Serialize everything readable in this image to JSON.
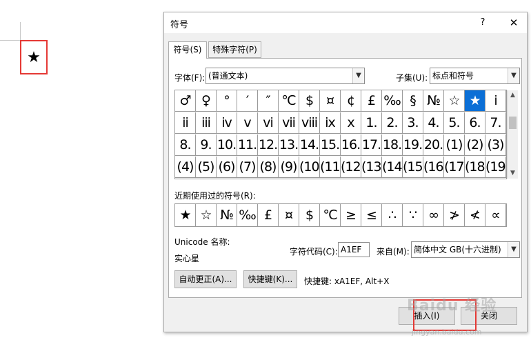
{
  "document": {
    "inserted_symbol": "★"
  },
  "dialog": {
    "title": "符号",
    "help": "?",
    "close": "✕",
    "tabs": [
      {
        "label": "符号(S)"
      },
      {
        "label": "特殊字符(P)"
      }
    ],
    "font": {
      "label": "字体(F):",
      "value": "(普通文本)"
    },
    "subset": {
      "label": "子集(U):",
      "value": "标点和符号"
    },
    "grid": [
      [
        "♂",
        "♀",
        "°",
        "′",
        "″",
        "℃",
        "$",
        "¤",
        "¢",
        "£",
        "‰",
        "§",
        "№",
        "☆",
        "★",
        "i"
      ],
      [
        "ii",
        "iii",
        "iv",
        "v",
        "vi",
        "vii",
        "viii",
        "ix",
        "x",
        "1.",
        "2.",
        "3.",
        "4.",
        "5.",
        "6.",
        "7."
      ],
      [
        "8.",
        "9.",
        "10.",
        "11.",
        "12.",
        "13.",
        "14.",
        "15.",
        "16.",
        "17.",
        "18.",
        "19.",
        "20.",
        "(1)",
        "(2)",
        "(3)"
      ],
      [
        "(4)",
        "(5)",
        "(6)",
        "(7)",
        "(8)",
        "(9)",
        "(10)",
        "(11)",
        "(12)",
        "(13)",
        "(14)",
        "(15)",
        "(16)",
        "(17)",
        "(18)",
        "(19)"
      ]
    ],
    "selected_symbol": "★",
    "recent_label": "近期使用过的符号(R):",
    "recent": [
      "★",
      "☆",
      "№",
      "‰",
      "£",
      "¤",
      "$",
      "℃",
      "≥",
      "≤",
      "∴",
      "∵",
      "∞",
      "≯",
      "≮",
      "∝"
    ],
    "unicode_name_label": "Unicode 名称:",
    "unicode_name": "实心星",
    "char_code": {
      "label": "字符代码(C):",
      "value": "A1EF"
    },
    "from": {
      "label": "来自(M):",
      "value": "简体中文 GB(十六进制)"
    },
    "autocorrect_button": "自动更正(A)...",
    "shortcut_button": "快捷键(K)...",
    "shortcut_text": "快捷键: xA1EF, Alt+X",
    "insert_button": "插入(I)",
    "close_button": "关闭"
  },
  "watermark": {
    "main": "Baidu 经验",
    "sub": "jingyan.baidu.com"
  },
  "colors": {
    "highlight": "#e53935",
    "selection": "#0b6fd6"
  }
}
